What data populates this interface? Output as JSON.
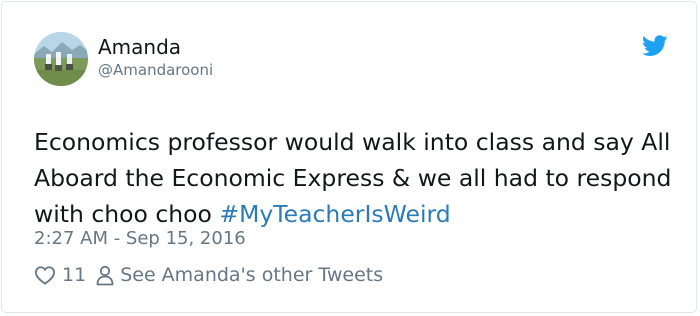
{
  "tweet": {
    "author": {
      "display_name": "Amanda",
      "handle": "@Amandarooni"
    },
    "text_main": "Economics professor would walk into class and say All Aboard the Economic Express & we all had to respond with choo choo ",
    "hashtag": "#MyTeacherIsWeird",
    "timestamp": "2:27 AM - Sep 15, 2016",
    "likes": "11",
    "other_tweets_label": "See Amanda's other Tweets"
  },
  "icons": {
    "brand": "twitter-bird-icon",
    "like": "heart-icon",
    "profile": "person-icon"
  },
  "colors": {
    "brand": "#1da1f2",
    "hashtag": "#2b7bb9",
    "muted": "#657786",
    "text": "#14171a",
    "border": "#e1e8ed"
  }
}
